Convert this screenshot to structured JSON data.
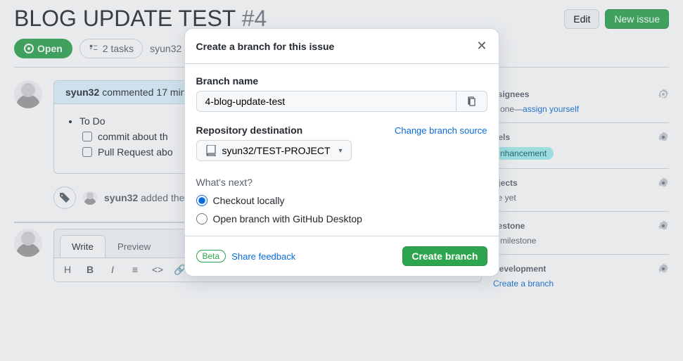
{
  "header": {
    "title": "BLOG UPDATE TEST",
    "number": "#4",
    "edit": "Edit",
    "new_issue": "New issue"
  },
  "meta": {
    "state": "Open",
    "tasks": "2 tasks",
    "author": "syun32",
    "opened_suffix": "o"
  },
  "comment": {
    "user": "syun32",
    "verb": "commented",
    "when": "17 min",
    "todo_heading": "To Do",
    "tasks": [
      "commit about th",
      "Pull Request abo"
    ]
  },
  "timeline": {
    "user": "syun32",
    "text": "added the"
  },
  "editor": {
    "tabs": {
      "write": "Write",
      "preview": "Preview"
    }
  },
  "sidebar": {
    "assignees": {
      "label": "ssignees",
      "body_prefix": "o one—",
      "link": "assign yourself"
    },
    "labels": {
      "label": "bels",
      "pill": "nhancement"
    },
    "projects": {
      "label": "ojects",
      "body": "ne yet"
    },
    "milestone": {
      "label": "ilestone",
      "body": "o milestone"
    },
    "development": {
      "label": "Development",
      "link": "Create a branch"
    }
  },
  "modal": {
    "title": "Create a branch for this issue",
    "branch_label": "Branch name",
    "branch_value": "4-blog-update-test",
    "repo_label": "Repository destination",
    "change_source": "Change branch source",
    "repo_value": "syun32/TEST-PROJECT",
    "whats_next": "What's next?",
    "option_checkout": "Checkout locally",
    "option_desktop": "Open branch with GitHub Desktop",
    "beta": "Beta",
    "feedback": "Share feedback",
    "create": "Create branch"
  }
}
